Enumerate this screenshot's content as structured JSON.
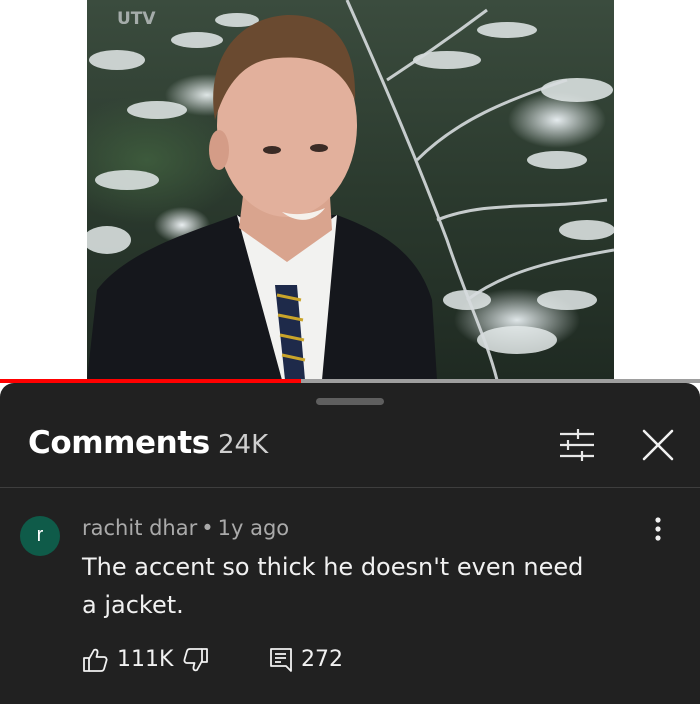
{
  "video": {
    "channel_logo": "UTV",
    "progress_fraction": 0.43,
    "colors": {
      "progress": "#ff0000",
      "track": "#9e9e9e"
    }
  },
  "comments_panel": {
    "title": "Comments",
    "count": "24K",
    "filter_icon": "filter-sliders-icon",
    "close_icon": "close-icon"
  },
  "comment": {
    "avatar_letter": "r",
    "avatar_color": "#0f5b49",
    "author": "rachit dhar",
    "separator": "•",
    "time_ago": "1y ago",
    "text": "The accent so thick he doesn't even need a jacket.",
    "likes": "111K",
    "replies": "272",
    "icons": [
      "thumbs-up-icon",
      "thumbs-down-icon",
      "reply-icon",
      "more-vert-icon"
    ]
  }
}
